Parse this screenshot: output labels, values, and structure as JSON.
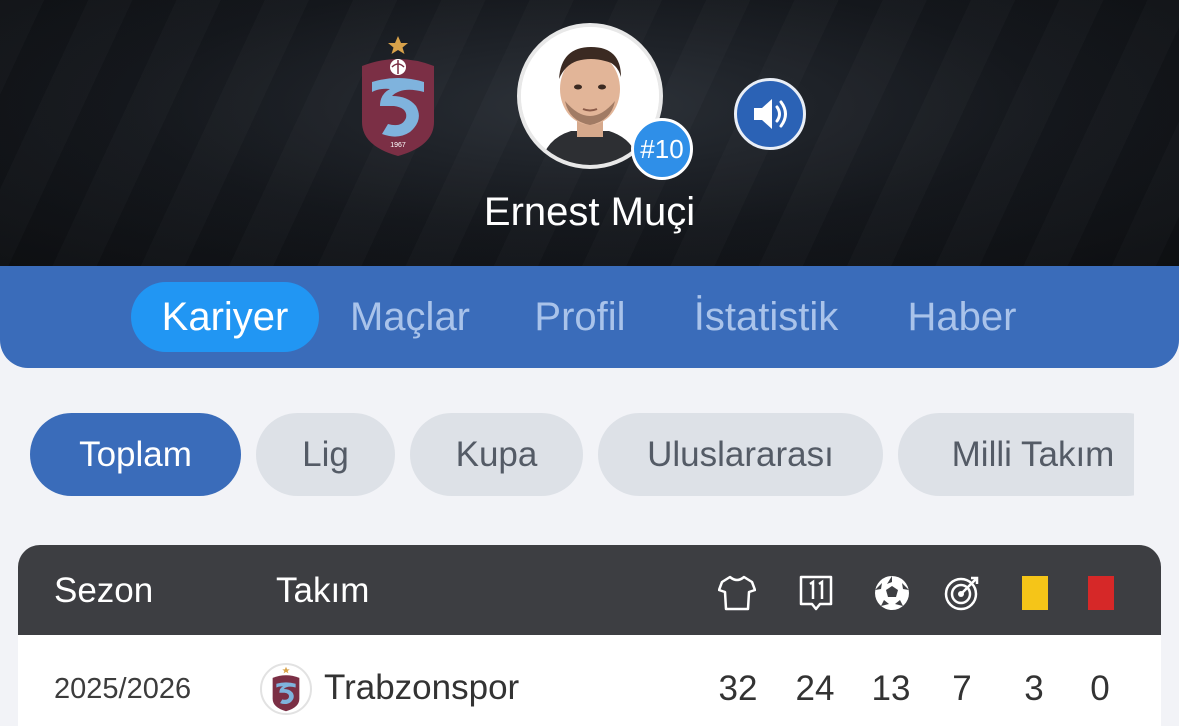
{
  "player": {
    "name": "Ernest Muçi",
    "jersey": "#10",
    "club_crest_year": "1967"
  },
  "tabs": [
    {
      "label": "Kariyer",
      "active": true
    },
    {
      "label": "Maçlar",
      "active": false
    },
    {
      "label": "Profil",
      "active": false
    },
    {
      "label": "İstatistik",
      "active": false
    },
    {
      "label": "Haber",
      "active": false
    }
  ],
  "filters": [
    {
      "label": "Toplam",
      "active": true
    },
    {
      "label": "Lig",
      "active": false
    },
    {
      "label": "Kupa",
      "active": false
    },
    {
      "label": "Uluslararası",
      "active": false
    },
    {
      "label": "Milli Takım",
      "active": false
    }
  ],
  "table": {
    "headers": {
      "season": "Sezon",
      "team": "Takım",
      "icons": [
        "shirt-icon",
        "lineup-icon",
        "ball-icon",
        "target-icon",
        "yellow-card-icon",
        "red-card-icon"
      ]
    },
    "rows": [
      {
        "season": "2025/2026",
        "team": "Trabzonspor",
        "stats": [
          "32",
          "24",
          "13",
          "7",
          "3",
          "0"
        ]
      }
    ]
  },
  "colors": {
    "primary_blue": "#3a6cba",
    "active_tab": "#2196f3",
    "club_maroon": "#7b2f45",
    "club_light_blue": "#7fb3dd",
    "yellow_card": "#f5c518",
    "red_card": "#d62828"
  }
}
